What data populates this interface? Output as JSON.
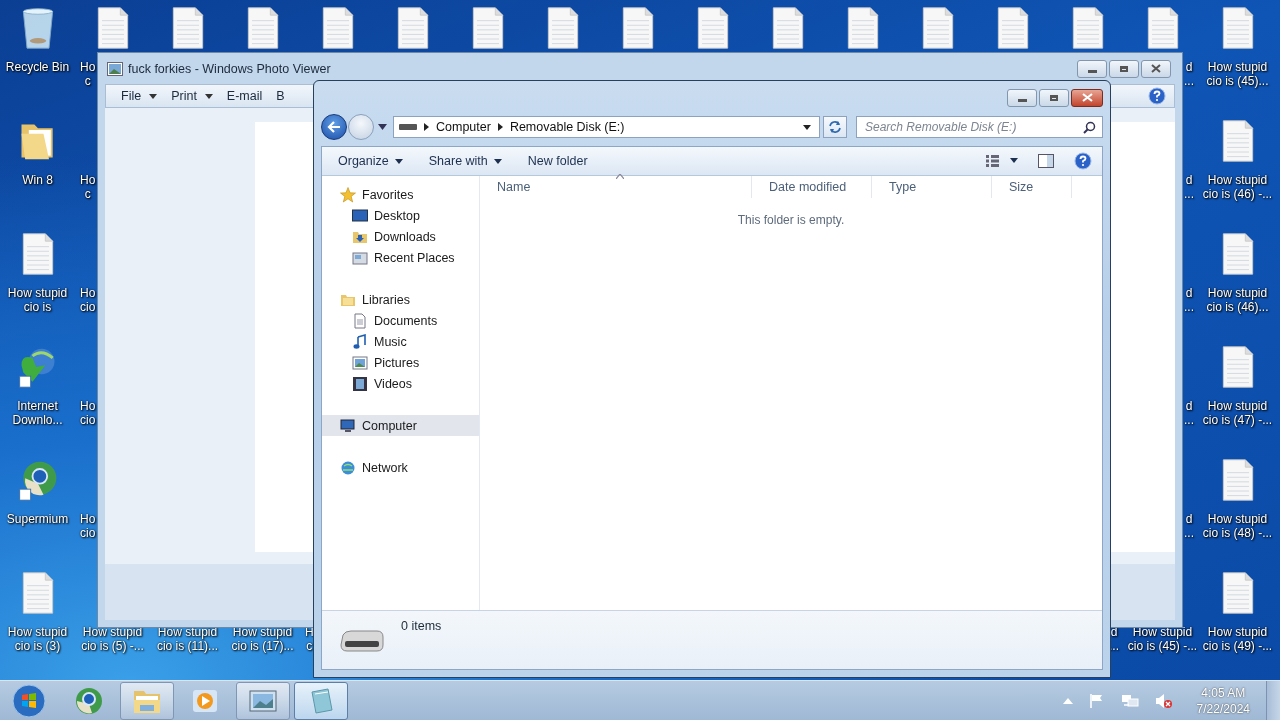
{
  "desktop_icons": [
    {
      "kind": "recycle-bin",
      "lines": [
        "Recycle Bin"
      ]
    },
    {
      "kind": "document",
      "lines": [
        "Ho",
        "c"
      ]
    },
    {
      "kind": "document"
    },
    {
      "kind": "document"
    },
    {
      "kind": "document"
    },
    {
      "kind": "document"
    },
    {
      "kind": "document"
    },
    {
      "kind": "document"
    },
    {
      "kind": "document"
    },
    {
      "kind": "document"
    },
    {
      "kind": "document"
    },
    {
      "kind": "document"
    },
    {
      "kind": "document"
    },
    {
      "kind": "document"
    },
    {
      "kind": "document"
    },
    {
      "kind": "document",
      "lines": [
        "d",
        "..."
      ]
    },
    {
      "kind": "document",
      "lines": [
        "How stupid",
        "cio is (45)..."
      ]
    },
    {
      "kind": "folder",
      "lines": [
        "Win 8"
      ]
    },
    {
      "kind": "label",
      "lines": [
        "Ho",
        "c"
      ]
    },
    {
      "kind": "label",
      "lines": [
        "d",
        "..."
      ]
    },
    {
      "kind": "document",
      "lines": [
        "How stupid",
        "cio is (46) -..."
      ]
    },
    {
      "kind": "document",
      "lines": [
        "How stupid",
        "cio is"
      ]
    },
    {
      "kind": "label",
      "lines": [
        "Ho",
        "cio"
      ]
    },
    {
      "kind": "label",
      "lines": [
        "d",
        "..."
      ]
    },
    {
      "kind": "document",
      "lines": [
        "How stupid",
        "cio is (46)..."
      ]
    },
    {
      "kind": "downloader",
      "lines": [
        "Internet",
        "Downlo..."
      ]
    },
    {
      "kind": "label",
      "lines": [
        "Ho",
        "cio"
      ]
    },
    {
      "kind": "label",
      "lines": [
        "d",
        "..."
      ]
    },
    {
      "kind": "document",
      "lines": [
        "How stupid",
        "cio is (47) -..."
      ]
    },
    {
      "kind": "browser",
      "lines": [
        "Supermium"
      ]
    },
    {
      "kind": "label",
      "lines": [
        "Ho",
        "cio"
      ]
    },
    {
      "kind": "label",
      "lines": [
        "d",
        "..."
      ]
    },
    {
      "kind": "document",
      "lines": [
        "How stupid",
        "cio is (48) -..."
      ]
    },
    {
      "kind": "document",
      "lines": [
        "How stupid",
        "cio is (3)"
      ]
    },
    {
      "kind": "label",
      "lines": [
        "How stupid",
        "cio is (5) -..."
      ]
    },
    {
      "kind": "label",
      "lines": [
        "How stupid",
        "cio is (11)..."
      ]
    },
    {
      "kind": "label",
      "lines": [
        "How stupid",
        "cio is (17)..."
      ]
    },
    {
      "kind": "label",
      "lines": [
        "H",
        "c"
      ]
    },
    {
      "kind": "label",
      "lines": [
        "d",
        "..."
      ]
    },
    {
      "kind": "label",
      "lines": [
        "How stupid",
        "cio is (45) -..."
      ]
    },
    {
      "kind": "document",
      "lines": [
        "How stupid",
        "cio is (49) -..."
      ]
    }
  ],
  "photo_viewer": {
    "title": "fuck forkies - Windows Photo Viewer",
    "toolbar": [
      {
        "label": "File",
        "dropdown": true
      },
      {
        "label": "Print",
        "dropdown": true
      },
      {
        "label": "E-mail",
        "dropdown": false
      },
      {
        "label": "B",
        "dropdown": false
      }
    ]
  },
  "explorer": {
    "breadcrumb": [
      "Computer",
      "Removable Disk (E:)"
    ],
    "search": {
      "placeholder": "Search Removable Disk (E:)"
    },
    "commands": [
      {
        "label": "Organize",
        "dropdown": true
      },
      {
        "label": "Share with",
        "dropdown": true
      },
      {
        "label": "New folder",
        "dropdown": false
      }
    ],
    "navigation": [
      {
        "label": "Favorites",
        "kind": "star",
        "selected": false,
        "children": [
          {
            "label": "Desktop",
            "kind": "desktop",
            "selected": false
          },
          {
            "label": "Downloads",
            "kind": "downloads",
            "selected": false
          },
          {
            "label": "Recent Places",
            "kind": "recent",
            "selected": false
          }
        ]
      },
      {
        "label": "Libraries",
        "kind": "library",
        "selected": false,
        "children": [
          {
            "label": "Documents",
            "kind": "documents",
            "selected": false
          },
          {
            "label": "Music",
            "kind": "music",
            "selected": false
          },
          {
            "label": "Pictures",
            "kind": "pictures",
            "selected": false
          },
          {
            "label": "Videos",
            "kind": "videos",
            "selected": false
          }
        ]
      },
      {
        "label": "Computer",
        "kind": "computer",
        "selected": true
      },
      {
        "label": "Network",
        "kind": "network",
        "selected": false
      }
    ],
    "columns": [
      {
        "label": "Name",
        "sorted": true
      },
      {
        "label": "Date modified",
        "sorted": false
      },
      {
        "label": "Type",
        "sorted": false
      },
      {
        "label": "Size",
        "sorted": false
      }
    ],
    "empty_message": "This folder is empty.",
    "item_count": "0 items"
  },
  "taskbar": {
    "buttons": [
      {
        "kind": "browser",
        "running": false,
        "highlighted": false
      },
      {
        "kind": "explorer",
        "running": true,
        "highlighted": false
      },
      {
        "kind": "media",
        "running": false,
        "highlighted": false
      },
      {
        "kind": "photos",
        "running": true,
        "highlighted": false
      },
      {
        "kind": "notepad",
        "running": true,
        "highlighted": true
      }
    ],
    "time": "4:05 AM",
    "date": "7/22/2024"
  }
}
